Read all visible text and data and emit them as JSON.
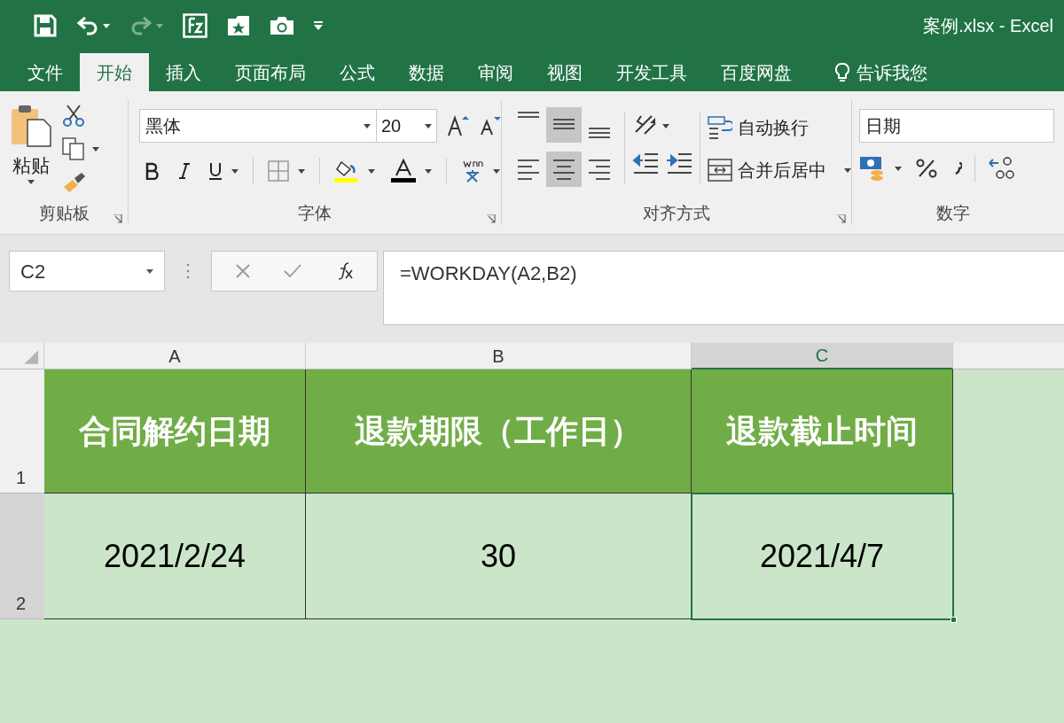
{
  "window": {
    "title": "案例.xlsx - Excel"
  },
  "quick_access": [
    {
      "kind": "save"
    },
    {
      "kind": "undo",
      "disabled": false
    },
    {
      "kind": "redo",
      "disabled": true
    },
    {
      "kind": "form"
    },
    {
      "kind": "folder"
    },
    {
      "kind": "camera"
    },
    {
      "kind": "customize"
    }
  ],
  "tabs": [
    {
      "label": "文件",
      "selected": false
    },
    {
      "label": "开始",
      "selected": true
    },
    {
      "label": "插入",
      "selected": false
    },
    {
      "label": "页面布局",
      "selected": false
    },
    {
      "label": "公式",
      "selected": false
    },
    {
      "label": "数据",
      "selected": false
    },
    {
      "label": "审阅",
      "selected": false
    },
    {
      "label": "视图",
      "selected": false
    },
    {
      "label": "开发工具",
      "selected": false
    },
    {
      "label": "百度网盘",
      "selected": false
    }
  ],
  "tell_me": "告诉我您",
  "ribbon": {
    "clipboard": {
      "paste_label": "粘贴",
      "group_label": "剪贴板"
    },
    "font": {
      "name": "黑体",
      "size": "20",
      "group_label": "字体"
    },
    "alignment": {
      "vertical": [
        {
          "kind": "top",
          "selected": false
        },
        {
          "kind": "middle",
          "selected": true
        },
        {
          "kind": "bottom",
          "selected": false
        }
      ],
      "horizontal": [
        {
          "kind": "left",
          "selected": false
        },
        {
          "kind": "center",
          "selected": true
        },
        {
          "kind": "right",
          "selected": false
        }
      ],
      "wrap_label": "自动换行",
      "merge_label": "合并后居中",
      "group_label": "对齐方式"
    },
    "number": {
      "format": "日期",
      "group_label": "数字"
    }
  },
  "formula_bar": {
    "name_box": "C2",
    "formula": "=WORKDAY(A2,B2)"
  },
  "sheet": {
    "columns": [
      {
        "label": "A",
        "selected": false
      },
      {
        "label": "B",
        "selected": false
      },
      {
        "label": "C",
        "selected": true
      }
    ],
    "rows": [
      {
        "label": "1",
        "selected": false,
        "kind": "header",
        "cells": [
          {
            "text": "合同解约日期",
            "selected": false
          },
          {
            "text": "退款期限（工作日）",
            "selected": false
          },
          {
            "text": "退款截止时间",
            "selected": false
          }
        ]
      },
      {
        "label": "2",
        "selected": true,
        "kind": "data",
        "cells": [
          {
            "text": "2021/2/24",
            "selected": false
          },
          {
            "text": "30",
            "selected": false
          },
          {
            "text": "2021/4/7",
            "selected": true
          }
        ]
      }
    ]
  }
}
